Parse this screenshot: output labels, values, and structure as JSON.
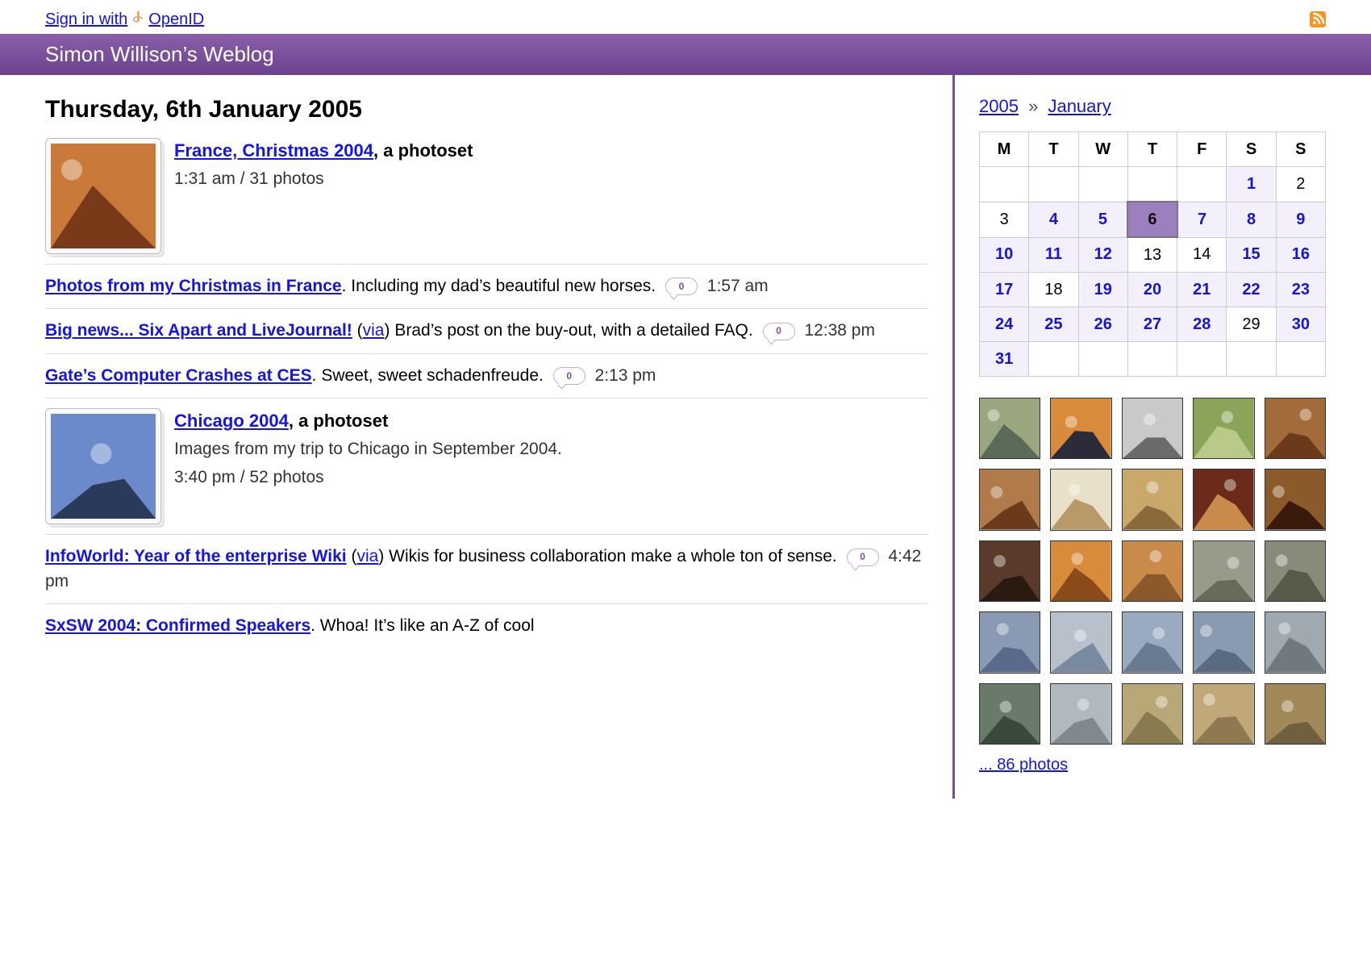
{
  "top": {
    "signin_prefix": "Sign in with",
    "openid": "OpenID"
  },
  "header": {
    "title": "Simon Willison’s Weblog"
  },
  "date_heading": "Thursday, 6th January 2005",
  "entries": [
    {
      "type": "photoset",
      "title": "France, Christmas 2004",
      "suffix": ", a photoset",
      "meta": "1:31 am / 31 photos"
    },
    {
      "type": "link",
      "title": "Photos from my Christmas in France",
      "body": ". Including my dad’s beautiful new horses.",
      "comments": "0",
      "time": "1:57 am"
    },
    {
      "type": "link",
      "title": "Big news... Six Apart and LiveJournal!",
      "via": "via",
      "body": " Brad’s post on the buy-out, with a detailed FAQ.",
      "comments": "0",
      "time": "12:38 pm"
    },
    {
      "type": "link",
      "title": "Gate’s Computer Crashes at CES",
      "body": ". Sweet, sweet schadenfreude.",
      "comments": "0",
      "time": "2:13 pm"
    },
    {
      "type": "photoset",
      "title": "Chicago 2004",
      "suffix": ", a photoset",
      "desc": "Images from my trip to Chicago in September 2004.",
      "meta": "3:40 pm / 52 photos"
    },
    {
      "type": "link",
      "title": "InfoWorld: Year of the enterprise Wiki",
      "via": "via",
      "body": " Wikis for business collaboration make a whole ton of sense.",
      "comments": "0",
      "time": "4:42 pm"
    },
    {
      "type": "link",
      "title": "SxSW 2004: Confirmed Speakers",
      "body": ". Whoa! It’s like an A-Z of cool"
    }
  ],
  "sidebar": {
    "crumb_year": "2005",
    "crumb_sep": "»",
    "crumb_month": "January",
    "days": [
      "M",
      "T",
      "W",
      "T",
      "F",
      "S",
      "S"
    ],
    "calendar": [
      [
        {
          "t": ""
        },
        {
          "t": ""
        },
        {
          "t": ""
        },
        {
          "t": ""
        },
        {
          "t": ""
        },
        {
          "t": "1",
          "l": true
        },
        {
          "t": "2"
        }
      ],
      [
        {
          "t": "3"
        },
        {
          "t": "4",
          "l": true
        },
        {
          "t": "5",
          "l": true,
          "s": true
        },
        {
          "t": "6",
          "l": true,
          "today": true
        },
        {
          "t": "7",
          "l": true
        },
        {
          "t": "8",
          "l": true,
          "s": true
        },
        {
          "t": "9",
          "l": true
        }
      ],
      [
        {
          "t": "10",
          "l": true
        },
        {
          "t": "11",
          "l": true
        },
        {
          "t": "12",
          "l": true
        },
        {
          "t": "13"
        },
        {
          "t": "14"
        },
        {
          "t": "15",
          "l": true
        },
        {
          "t": "16",
          "l": true
        }
      ],
      [
        {
          "t": "17",
          "l": true,
          "s": true
        },
        {
          "t": "18"
        },
        {
          "t": "19",
          "l": true
        },
        {
          "t": "20",
          "l": true,
          "s": true
        },
        {
          "t": "21",
          "l": true
        },
        {
          "t": "22",
          "l": true
        },
        {
          "t": "23",
          "l": true
        }
      ],
      [
        {
          "t": "24",
          "l": true
        },
        {
          "t": "25",
          "l": true
        },
        {
          "t": "26",
          "l": true,
          "s": true
        },
        {
          "t": "27",
          "l": true
        },
        {
          "t": "28",
          "l": true
        },
        {
          "t": "29"
        },
        {
          "t": "30",
          "l": true
        }
      ],
      [
        {
          "t": "31",
          "l": true
        },
        {
          "t": ""
        },
        {
          "t": ""
        },
        {
          "t": ""
        },
        {
          "t": ""
        },
        {
          "t": ""
        },
        {
          "t": ""
        }
      ]
    ],
    "photos_more": "... 86 photos",
    "thumb_colors": [
      [
        "#9aa77e",
        "#5b6b58"
      ],
      [
        "#d88b3a",
        "#2b2b3a"
      ],
      [
        "#c9c9c9",
        "#6b6b6b"
      ],
      [
        "#8aa55a",
        "#b8c98a"
      ],
      [
        "#a36b3a",
        "#6b3a1a"
      ],
      [
        "#b07a4a",
        "#6b3a1a"
      ],
      [
        "#e8e0c8",
        "#b89a6a"
      ],
      [
        "#c9a86a",
        "#8a6a3a"
      ],
      [
        "#6b2a1a",
        "#c98a4a"
      ],
      [
        "#8a5a2a",
        "#3a1a0a"
      ],
      [
        "#5a3a2a",
        "#2a1a10"
      ],
      [
        "#d88b3a",
        "#8a4a1a"
      ],
      [
        "#c98a4a",
        "#8a5a2a"
      ],
      [
        "#9a9a8a",
        "#6a6a5a"
      ],
      [
        "#8a8a7a",
        "#5a5a4a"
      ],
      [
        "#8a9ab5",
        "#5a6a8a"
      ],
      [
        "#b8c0cc",
        "#7a8aa0"
      ],
      [
        "#9aaac0",
        "#6a7a90"
      ],
      [
        "#8a9ab0",
        "#5a6a80"
      ],
      [
        "#a0a8b0",
        "#707880"
      ],
      [
        "#6a7a6a",
        "#3a4a3a"
      ],
      [
        "#b0b8c0",
        "#808890"
      ],
      [
        "#b8a878",
        "#8a7a50"
      ],
      [
        "#c0a878",
        "#907850"
      ],
      [
        "#a08858",
        "#706040"
      ]
    ]
  }
}
